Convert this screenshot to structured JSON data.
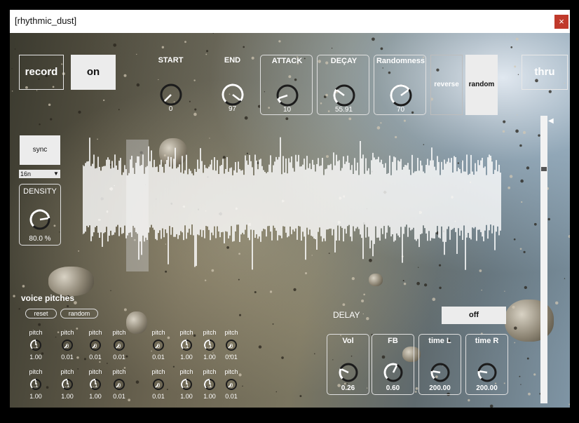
{
  "window": {
    "title": "[rhythmic_dust]",
    "close_symbol": "×"
  },
  "top": {
    "record": "record",
    "on": "on",
    "thru": "thru",
    "reverse": "reverse",
    "random": "random",
    "knobs": [
      {
        "id": "start",
        "label": "START",
        "value": "0",
        "level": 0.0
      },
      {
        "id": "end",
        "label": "END",
        "value": "97",
        "level": 0.97
      },
      {
        "id": "attack",
        "label": "ATTACK",
        "value": "10",
        "level": 0.1
      },
      {
        "id": "decay",
        "label": "DEÇAY",
        "value": "55.91",
        "level": 0.3
      },
      {
        "id": "randomness",
        "label": "Randomness",
        "value": "70",
        "level": 0.7
      }
    ]
  },
  "left": {
    "sync": "sync",
    "division": "16n",
    "density_label": "DENSITY",
    "density_value": "80.0 %",
    "density_level": 0.8
  },
  "voice": {
    "title": "voice pitches",
    "reset": "reset",
    "random": "random",
    "knob_label": "pitch",
    "row1": [
      {
        "num": ".1",
        "val": "1.00"
      },
      {
        "num": "0",
        "val": "0.01"
      },
      {
        "num": "0",
        "val": "0.01"
      },
      {
        "num": "0",
        "val": "0.01"
      },
      {
        "num": "0",
        "val": "0.01"
      },
      {
        "num": ".1",
        "val": "1.00"
      },
      {
        "num": ".1",
        "val": "1.00"
      },
      {
        "num": "0",
        "val": "0.01"
      }
    ],
    "row2": [
      {
        "num": ".1",
        "val": "1.00"
      },
      {
        "num": ".1",
        "val": "1.00"
      },
      {
        "num": ".1",
        "val": "1.00"
      },
      {
        "num": "0",
        "val": "0.01"
      },
      {
        "num": "0",
        "val": "0.01"
      },
      {
        "num": ".1",
        "val": "1.00"
      },
      {
        "num": ".1",
        "val": "1.00"
      },
      {
        "num": "0",
        "val": "0.01"
      }
    ]
  },
  "delay": {
    "label": "DELAY",
    "toggle": "off",
    "knobs": [
      {
        "id": "vol",
        "label": "Vol",
        "value": "0.26",
        "level": 0.26
      },
      {
        "id": "fb",
        "label": "FB",
        "value": "0.60",
        "level": 0.6
      },
      {
        "id": "timel",
        "label": "time L",
        "value": "200.00",
        "level": 0.2
      },
      {
        "id": "timer",
        "label": "time R",
        "value": "200.00",
        "level": 0.2
      }
    ]
  },
  "slider": {
    "level": 0.82
  },
  "colors": {
    "panel_border": "#e0e0e0",
    "button_fill": "#ececec",
    "close": "#c0392b",
    "waveform": "#ffffff"
  }
}
